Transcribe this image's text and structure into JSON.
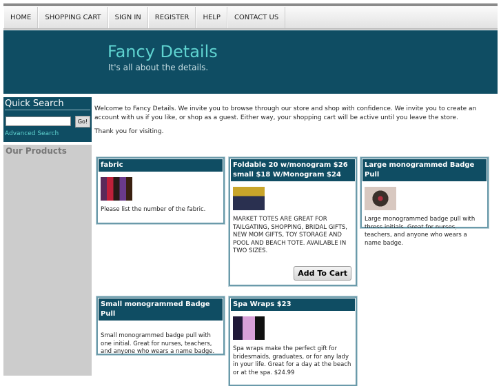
{
  "nav": [
    "HOME",
    "SHOPPING CART",
    "SIGN IN",
    "REGISTER",
    "HELP",
    "CONTACT US"
  ],
  "header": {
    "title": "Fancy Details",
    "tagline": "It's all about the details."
  },
  "quick_search": {
    "title": "Quick Search",
    "value": "",
    "go": "Go!",
    "advanced": "Advanced Search"
  },
  "products_title": "Our Products",
  "welcome": [
    "Welcome to Fancy Details. We invite you to browse through our store and shop with confidence. We invite you to create an account with us if you like, or shop as a guest. Either way, your shopping cart will be active until you leave the store.",
    "Thank you for visiting."
  ],
  "cards": [
    {
      "title": "fabric",
      "desc": "Please list the number of the fabric.",
      "image": "fabric-photo"
    },
    {
      "title": "Foldable 20 w/monogram $26 small $18 W/Monogram $24",
      "desc": "MARKET TOTES ARE GREAT FOR TAILGATING, SHOPPING, BRIDAL GIFTS, NEW MOM GIFTS, TOY STORAGE AND POOL AND BEACH TOTE. AVAILABLE IN TWO SIZES.",
      "image": "tote-photo",
      "button": "Add To Cart"
    },
    {
      "title": "Large monogrammed Badge Pull",
      "desc": "Large monogrammed badge pull with thress initials. Great for nurses, teachers, and anyone who wears a name badge.",
      "image": "badge-photo"
    },
    {
      "title": "Small monogrammed Badge Pull",
      "desc": "Small monogrammed badge pull with one initial. Great for nurses, teachers, and anyone who wears a name badge."
    },
    {
      "title": "Spa Wraps $23",
      "desc": "Spa wraps make the perfect gift for bridesmaids, graduates, or for any lady in your life. Great for a day at the beach or at the spa. $24.99",
      "image": "spa-wrap-photo"
    }
  ],
  "colors": {
    "header_bg": "#0f4d63",
    "title": "#5fd3d0",
    "sidebar_gray": "#cccccc"
  }
}
